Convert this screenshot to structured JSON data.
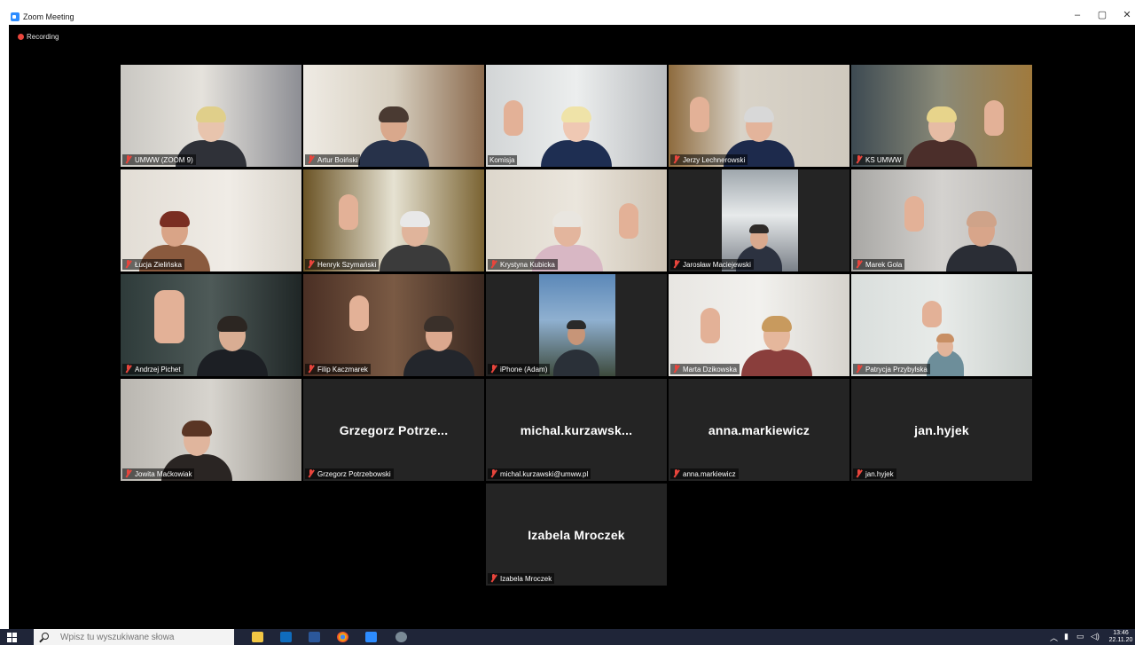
{
  "window": {
    "title": "Zoom Meeting",
    "recording": "Recording"
  },
  "participants": [
    {
      "name": "UMWW (ZOOM 9)",
      "display": "",
      "muted": true,
      "active": false
    },
    {
      "name": "Artur Boiński",
      "display": "",
      "muted": true,
      "active": false
    },
    {
      "name": "Komisja",
      "display": "",
      "muted": false,
      "active": true
    },
    {
      "name": "Jerzy Lechnerowski",
      "display": "",
      "muted": true,
      "active": false
    },
    {
      "name": "KS UMWW",
      "display": "",
      "muted": true,
      "active": false
    },
    {
      "name": "Łucja Zielińska",
      "display": "",
      "muted": true,
      "active": false
    },
    {
      "name": "Henryk Szymański",
      "display": "",
      "muted": true,
      "active": false
    },
    {
      "name": "Krystyna Kubicka",
      "display": "",
      "muted": true,
      "active": false
    },
    {
      "name": "Jarosław Maciejewski",
      "display": "",
      "muted": true,
      "active": false
    },
    {
      "name": "Marek Gola",
      "display": "",
      "muted": true,
      "active": false
    },
    {
      "name": "Andrzej Pichet",
      "display": "",
      "muted": true,
      "active": false
    },
    {
      "name": "Filip Kaczmarek",
      "display": "",
      "muted": true,
      "active": false
    },
    {
      "name": "iPhone (Adam)",
      "display": "",
      "muted": true,
      "active": false
    },
    {
      "name": "Marta Dzikowska",
      "display": "",
      "muted": true,
      "active": false
    },
    {
      "name": "Patrycja Przybylska",
      "display": "",
      "muted": true,
      "active": false
    },
    {
      "name": "Jowita Maćkowiak",
      "display": "",
      "muted": true,
      "active": false
    },
    {
      "name": "Grzegorz Potrzebowski",
      "display": "Grzegorz Potrze...",
      "muted": true,
      "active": false
    },
    {
      "name": "michal.kurzawski@umww.pl",
      "display": "michal.kurzawsk...",
      "muted": true,
      "active": false
    },
    {
      "name": "anna.markiewicz",
      "display": "anna.markiewicz",
      "muted": true,
      "active": false
    },
    {
      "name": "jan.hyjek",
      "display": "jan.hyjek",
      "muted": true,
      "active": false
    },
    {
      "name": "Izabela Mroczek",
      "display": "Izabela Mroczek",
      "muted": true,
      "active": false
    }
  ],
  "taskbar": {
    "search_placeholder": "Wpisz tu wyszukiwane słowa",
    "time": "13:46",
    "date": "22.11.20"
  }
}
